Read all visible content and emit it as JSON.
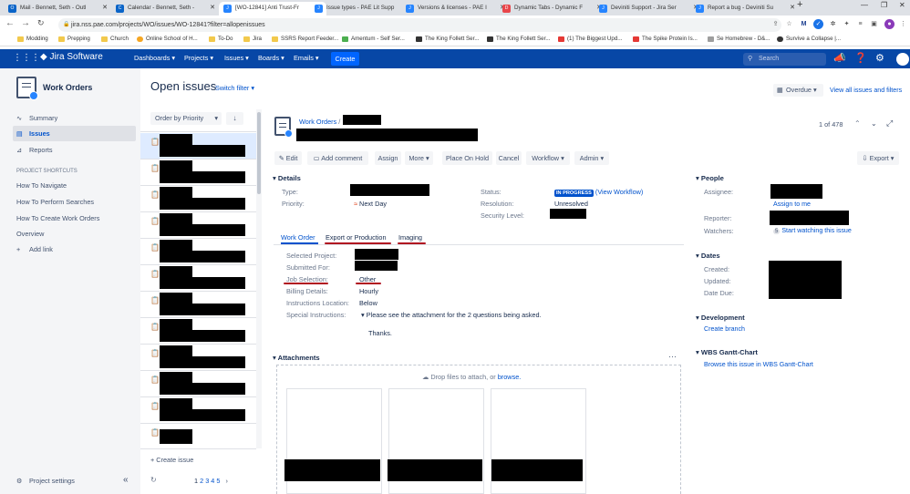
{
  "browser": {
    "tabs": [
      {
        "title": "Mail - Bennett, Seth - Outl",
        "color": "#0a64c8",
        "glyph": "O"
      },
      {
        "title": "Calendar - Bennett, Seth -",
        "color": "#0a64c8",
        "glyph": "C"
      },
      {
        "title": "[WO-12841] Anti Trust-Fr",
        "color": "#2684ff",
        "glyph": "J",
        "active": true
      },
      {
        "title": "Issue types - PAE Lit Supp",
        "color": "#2684ff",
        "glyph": "J"
      },
      {
        "title": "Versions & licenses - PAE I",
        "color": "#2684ff",
        "glyph": "J"
      },
      {
        "title": "Dynamic Tabs - Dynamic F",
        "color": "#e8454a",
        "glyph": "D"
      },
      {
        "title": "Deviniti Support - Jira Ser",
        "color": "#2684ff",
        "glyph": "J"
      },
      {
        "title": "Report a bug - Deviniti Su",
        "color": "#2684ff",
        "glyph": "J"
      }
    ],
    "url": "jira.nss.pae.com/projects/WO/issues/WO-12841?filter=allopenissues",
    "bookmarks": [
      "Modding",
      "Prepping",
      "Church",
      "Online School of H...",
      "To-Do",
      "Jira",
      "SSRS Report Feeder...",
      "Amentum - Self Ser...",
      "The King Follett Ser...",
      "The King Follett Ser...",
      "(1) The Biggest Upd...",
      "The Spike Protein Is...",
      "Se Homebrew - D&...",
      "Survive a Collapse |..."
    ]
  },
  "jira_nav": {
    "product": "Jira Software",
    "items": [
      "Dashboards",
      "Projects",
      "Issues",
      "Boards",
      "Emails"
    ],
    "create": "Create",
    "search_placeholder": "Search"
  },
  "sidebar": {
    "project_name": "Work Orders",
    "items": [
      {
        "label": "Summary",
        "icon": "pulse-icon"
      },
      {
        "label": "Issues",
        "icon": "issues-icon",
        "selected": true
      },
      {
        "label": "Reports",
        "icon": "chart-icon"
      }
    ],
    "shortcuts_heading": "PROJECT SHORTCUTS",
    "shortcuts": [
      "How To Navigate",
      "How To Perform Searches",
      "How To Create Work Orders",
      "Overview"
    ],
    "add_link": "Add link",
    "settings": "Project settings"
  },
  "issue_list": {
    "heading": "Open issues",
    "switch_filter": "Switch filter",
    "order_by": "Order by Priority",
    "create_issue": "Create issue",
    "pages": [
      "1",
      "2",
      "3",
      "4",
      "5"
    ]
  },
  "toolbar": {
    "overdue": "Overdue",
    "view_all": "View all issues and filters",
    "counter": "1 of 478"
  },
  "issue": {
    "breadcrumb_project": "Work Orders",
    "actions": [
      "Edit",
      "Add comment",
      "Assign",
      "More",
      "Place On Hold",
      "Cancel",
      "Workflow",
      "Admin"
    ],
    "export": "Export",
    "details_heading": "Details",
    "type_label": "Type:",
    "priority_label": "Priority:",
    "priority_value": "Next Day",
    "status_label": "Status:",
    "status_value": "IN PROGRESS",
    "view_workflow": "(View Workflow)",
    "resolution_label": "Resolution:",
    "resolution_value": "Unresolved",
    "security_label": "Security Level:",
    "tabs": [
      "Work Order",
      "Export or Production",
      "Imaging"
    ],
    "fields": [
      {
        "label": "Selected Project:",
        "value": ""
      },
      {
        "label": "Submitted For:",
        "value": ""
      },
      {
        "label": "Job Selection:",
        "value": "Other"
      },
      {
        "label": "Billing Details:",
        "value": "Hourly"
      },
      {
        "label": "Instructions Location:",
        "value": "Below"
      },
      {
        "label": "Special Instructions:",
        "value": "Please see the attachment for the 2 questions being asked."
      }
    ],
    "thanks": "Thanks.",
    "attachments_heading": "Attachments",
    "drop_text": "Drop files to attach, or",
    "browse": "browse."
  },
  "right_panel": {
    "people_heading": "People",
    "assignee_label": "Assignee:",
    "assign_to_me": "Assign to me",
    "reporter_label": "Reporter:",
    "watchers_label": "Watchers:",
    "watchers_count": "5",
    "start_watching": "Start watching this issue",
    "dates_heading": "Dates",
    "created_label": "Created:",
    "updated_label": "Updated:",
    "due_label": "Date Due:",
    "development_heading": "Development",
    "create_branch": "Create branch",
    "gantt_heading": "WBS Gantt-Chart",
    "gantt_link": "Browse this issue in WBS Gantt-Chart"
  },
  "colors": {
    "jira_blue": "#0747a6",
    "link": "#0052cc",
    "status": "#0052cc",
    "annotation": "#b01020"
  }
}
